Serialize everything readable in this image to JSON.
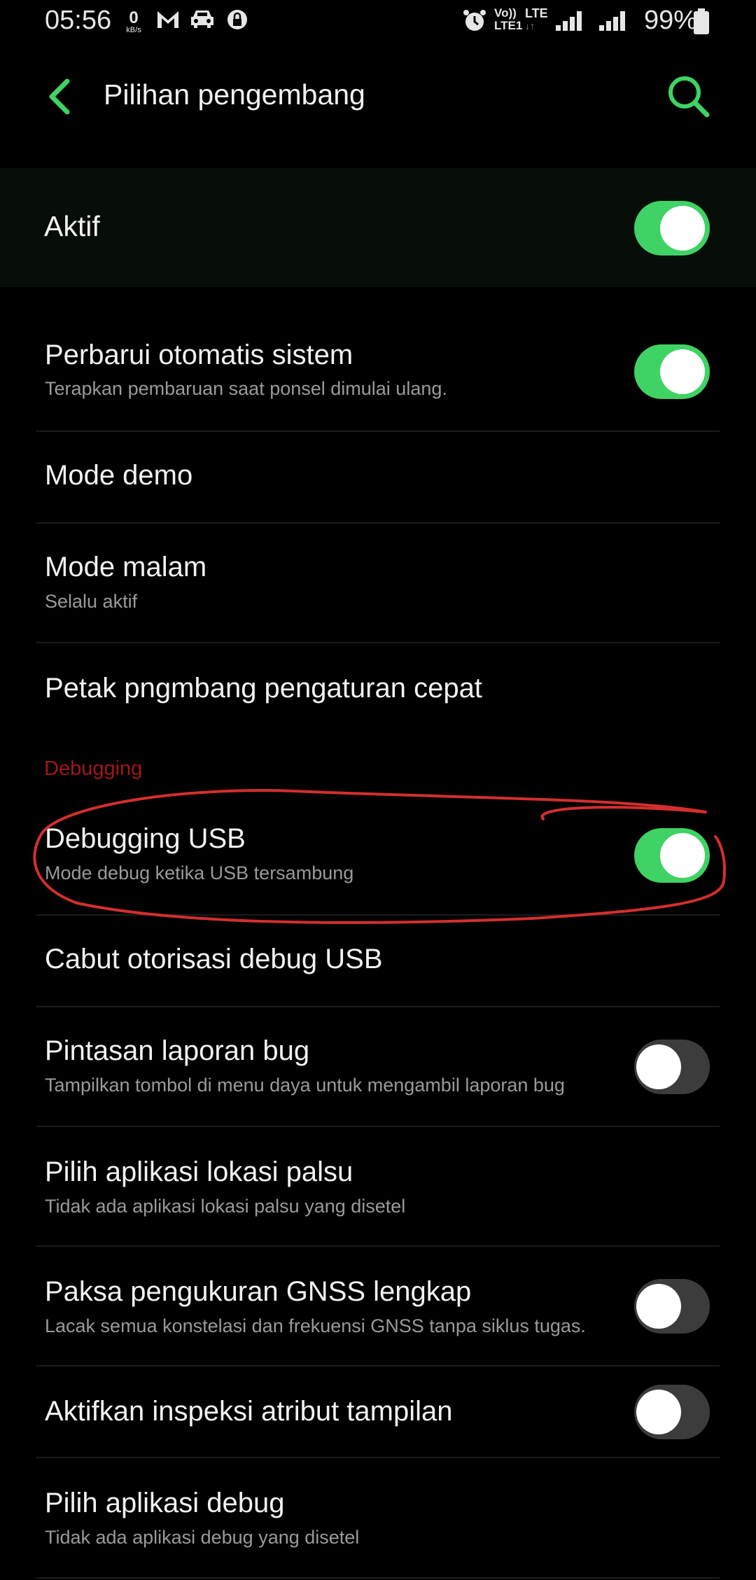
{
  "status_bar": {
    "time": "05:56",
    "speed_value": "0",
    "speed_unit": "kB/s",
    "volte_line1": "Vo))",
    "volte_line2": "LTE1",
    "lte": "LTE",
    "battery": "99%",
    "icons": [
      "gmail-icon",
      "car-icon",
      "lock-icon",
      "alarm-icon",
      "signal-icon",
      "signal-icon",
      "battery-icon"
    ]
  },
  "header": {
    "title": "Pilihan pengembang"
  },
  "master": {
    "label": "Aktif",
    "on": true
  },
  "settings": [
    {
      "title": "Perbarui otomatis sistem",
      "summary": "Terapkan pembaruan saat ponsel dimulai ulang.",
      "toggle": "on"
    },
    {
      "title": "Mode demo"
    },
    {
      "title": "Mode malam",
      "summary": "Selalu aktif"
    },
    {
      "title": "Petak pngmbang pengaturan cepat"
    },
    {
      "section": "Debugging"
    },
    {
      "title": "Debugging USB",
      "summary": "Mode debug ketika USB tersambung",
      "toggle": "on"
    },
    {
      "title": "Cabut otorisasi debug USB"
    },
    {
      "title": "Pintasan laporan bug",
      "summary": "Tampilkan tombol di menu daya untuk mengambil laporan bug",
      "toggle": "off"
    },
    {
      "title": "Pilih aplikasi lokasi palsu",
      "summary": "Tidak ada aplikasi lokasi palsu yang disetel"
    },
    {
      "title": "Paksa pengukuran GNSS lengkap",
      "summary": "Lacak semua konstelasi dan frekuensi GNSS tanpa siklus tugas.",
      "toggle": "off"
    },
    {
      "title": "Aktifkan inspeksi atribut tampilan",
      "toggle": "off"
    },
    {
      "title": "Pilih aplikasi debug",
      "summary": "Tidak ada aplikasi debug yang disetel"
    }
  ],
  "colors": {
    "accent": "#3fd264",
    "background": "#000000",
    "section_header": "#a01818",
    "annotation": "#d32f2f"
  }
}
